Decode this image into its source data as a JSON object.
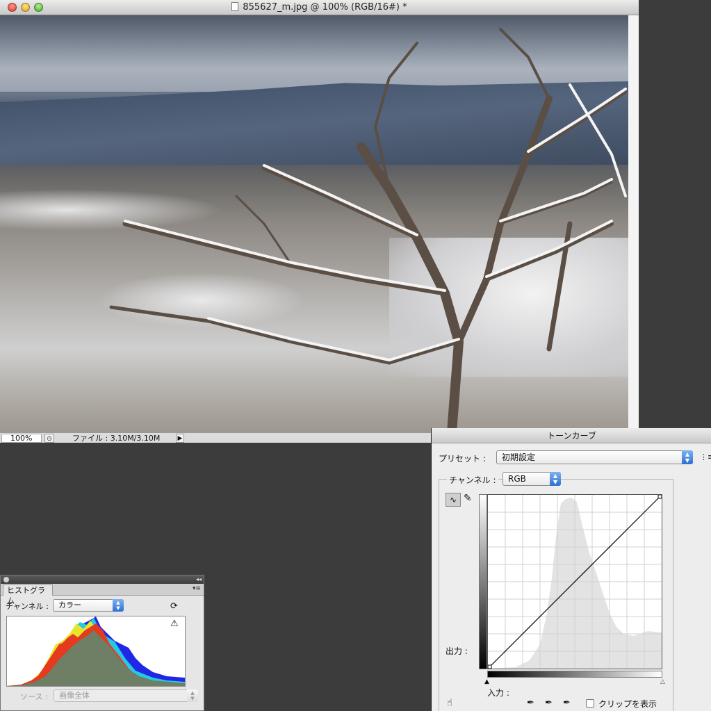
{
  "document": {
    "title": "855627_m.jpg @ 100% (RGB/16#) *",
    "zoom": "100%",
    "file_info": "ファイル : 3.10M/3.10M"
  },
  "histogram_panel": {
    "tab": "ヒストグラム",
    "channel_label": "チャンネル :",
    "channel_value": "カラー",
    "source_label": "ソース :",
    "source_value": "画像全体",
    "refresh_icon": "refresh-icon",
    "warning_icon": "warning-icon"
  },
  "curves_panel": {
    "title": "トーンカーブ",
    "preset_label": "プリセット :",
    "preset_value": "初期設定",
    "channel_label": "チャンネル :",
    "channel_value": "RGB",
    "output_label": "出力 :",
    "input_label": "入力 :",
    "clip_label": "クリップを表示",
    "clip_checked": false
  },
  "colors": {
    "accent_blue": "#2d6fd3",
    "panel_bg": "#ededed",
    "desktop_bg": "#3c3c3c"
  }
}
